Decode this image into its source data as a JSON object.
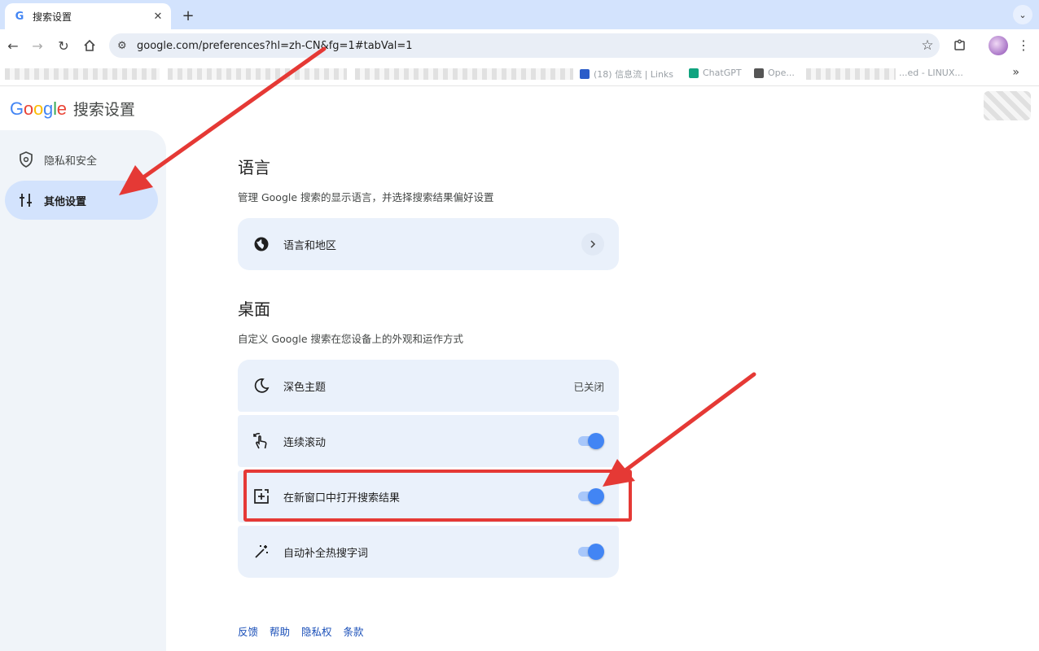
{
  "browser": {
    "tab_title": "搜索设置",
    "tab_favicon": "G",
    "url": "google.com/preferences?hl=zh-CN&fg=1#tabVal=1",
    "bookmarks": [
      {
        "label": "(18) 信息流 | Links",
        "icon_color": "#2b5cc9"
      },
      {
        "label": "ChatGPT",
        "icon_color": "#10a37f"
      },
      {
        "label": "Ope...",
        "icon_color": "#555555"
      },
      {
        "label": "...ed - LINUX...",
        "icon_color": "#888888"
      }
    ]
  },
  "header": {
    "logo_text": "Google",
    "page_title": "搜索设置"
  },
  "sidebar": {
    "items": [
      {
        "label": "隐私和安全",
        "icon": "shield-icon",
        "active": false
      },
      {
        "label": "其他设置",
        "icon": "tune-sliders-icon",
        "active": true
      }
    ]
  },
  "language_section": {
    "title": "语言",
    "description": "管理 Google 搜索的显示语言，并选择搜索结果偏好设置",
    "card_label": "语言和地区",
    "card_icon": "globe-icon"
  },
  "desktop_section": {
    "title": "桌面",
    "description": "自定义 Google 搜索在您设备上的外观和运作方式",
    "dark_theme": {
      "label": "深色主题",
      "value": "已关闭",
      "icon": "moon-icon"
    },
    "continuous_scroll": {
      "label": "连续滚动",
      "enabled": true,
      "icon": "swipe-icon"
    },
    "new_window": {
      "label": "在新窗口中打开搜索结果",
      "enabled": true,
      "icon": "open-in-new-window-icon"
    },
    "autocomplete": {
      "label": "自动补全热搜字词",
      "enabled": true,
      "icon": "magic-wand-icon"
    }
  },
  "footer": {
    "links": [
      "反馈",
      "帮助",
      "隐私权",
      "条款"
    ]
  },
  "colors": {
    "accent": "#4285f4",
    "annotation": "#e53935",
    "sidebar_active": "#d3e3fd",
    "card_bg": "#eaf1fb"
  }
}
